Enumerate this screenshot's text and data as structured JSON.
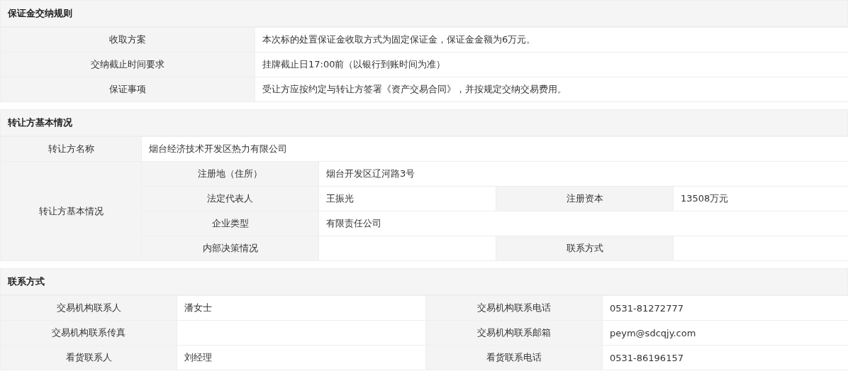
{
  "sections": [
    {
      "title": "保证金交纳规则",
      "rows": [
        [
          {
            "kind": "label",
            "text": "收取方案"
          },
          {
            "kind": "value",
            "text": "本次标的处置保证金收取方式为固定保证金，保证金金额为6万元。"
          }
        ],
        [
          {
            "kind": "label",
            "text": "交纳截止时间要求"
          },
          {
            "kind": "value",
            "text": "挂牌截止日17:00前（以银行到账时间为准）"
          }
        ],
        [
          {
            "kind": "label",
            "text": "保证事项"
          },
          {
            "kind": "value",
            "text": "受让方应按约定与转让方签署《资产交易合同》，并按规定交纳交易费用。"
          }
        ]
      ]
    },
    {
      "title": "转让方基本情况",
      "rows": [
        [
          {
            "kind": "label",
            "text": "转让方名称"
          },
          {
            "kind": "value",
            "text": "烟台经济技术开发区热力有限公司",
            "colspan": 4
          }
        ],
        [
          {
            "kind": "label",
            "text": "转让方基本情况",
            "rowspan": 4
          },
          {
            "kind": "label",
            "text": "注册地（住所）"
          },
          {
            "kind": "value",
            "text": "烟台开发区辽河路3号",
            "colspan": 3
          }
        ],
        [
          {
            "kind": "label",
            "text": "法定代表人"
          },
          {
            "kind": "value",
            "text": "王振光"
          },
          {
            "kind": "label",
            "text": "注册资本"
          },
          {
            "kind": "value",
            "text": "13508万元"
          }
        ],
        [
          {
            "kind": "label",
            "text": "企业类型"
          },
          {
            "kind": "value",
            "text": "有限责任公司",
            "colspan": 3
          }
        ],
        [
          {
            "kind": "label",
            "text": "内部决策情况"
          },
          {
            "kind": "value"
          },
          {
            "kind": "label",
            "text": "联系方式"
          },
          {
            "kind": "value"
          }
        ]
      ]
    },
    {
      "title": "联系方式",
      "rows": [
        [
          {
            "kind": "label",
            "text": "交易机构联系人"
          },
          {
            "kind": "value",
            "text": "潘女士"
          },
          {
            "kind": "label",
            "text": "交易机构联系电话"
          },
          {
            "kind": "value",
            "text": "0531-81272777"
          }
        ],
        [
          {
            "kind": "label",
            "text": "交易机构联系传真"
          },
          {
            "kind": "value"
          },
          {
            "kind": "label",
            "text": "交易机构联系邮箱"
          },
          {
            "kind": "value",
            "text": "peym@sdcqjy.com"
          }
        ],
        [
          {
            "kind": "label",
            "text": "看货联系人"
          },
          {
            "kind": "value",
            "text": "刘经理"
          },
          {
            "kind": "label",
            "text": "看货联系电话"
          },
          {
            "kind": "value",
            "text": "0531-86196157"
          }
        ]
      ]
    }
  ]
}
